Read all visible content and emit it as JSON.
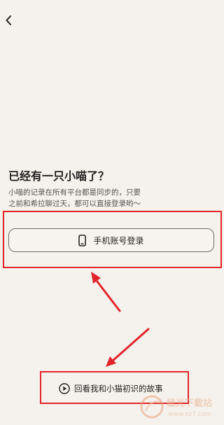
{
  "header": {
    "back_icon": "chevron-left-icon"
  },
  "intro": {
    "title": "已经有一只小喵了？",
    "description_line1": "小喵的记录在所有平台都是同步的，只要",
    "description_line2": "之前和希拉聊过天，都可以直接登录哟～"
  },
  "login": {
    "icon": "phone-icon",
    "label": "手机账号登录"
  },
  "story": {
    "icon": "play-circle-icon",
    "label": "回看我和小猫初识的故事"
  },
  "annotations": {
    "color": "#e2252b"
  },
  "watermark": {
    "text": "極光下載站",
    "url": "www.xz7.com"
  }
}
